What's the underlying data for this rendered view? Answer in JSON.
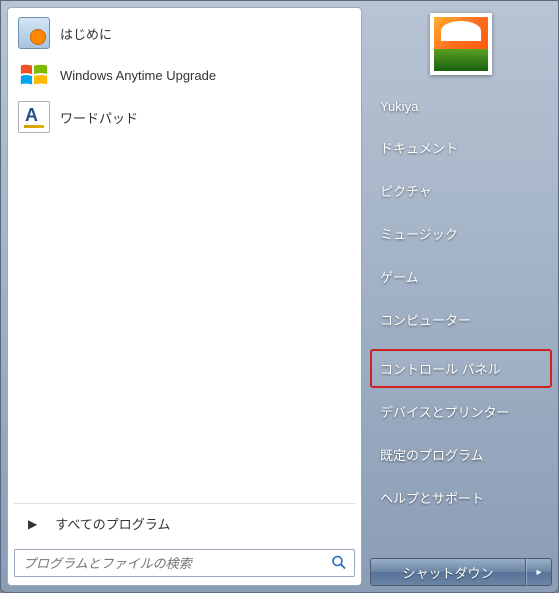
{
  "left": {
    "programs": [
      {
        "label": "はじめに",
        "icon": "getting-started-icon"
      },
      {
        "label": "Windows Anytime Upgrade",
        "icon": "windows-flag-icon"
      },
      {
        "label": "ワードパッド",
        "icon": "wordpad-icon"
      }
    ],
    "all_programs_label": "すべてのプログラム",
    "search_placeholder": "プログラムとファイルの検索"
  },
  "right": {
    "username": "Yukiya",
    "items": [
      {
        "label": "ドキュメント",
        "name": "documents"
      },
      {
        "label": "ピクチャ",
        "name": "pictures"
      },
      {
        "label": "ミュージック",
        "name": "music"
      },
      {
        "label": "ゲーム",
        "name": "games"
      },
      {
        "label": "コンピューター",
        "name": "computer"
      },
      {
        "label": "コントロール パネル",
        "name": "control-panel",
        "highlighted": true
      },
      {
        "label": "デバイスとプリンター",
        "name": "devices-printers"
      },
      {
        "label": "既定のプログラム",
        "name": "default-programs"
      },
      {
        "label": "ヘルプとサポート",
        "name": "help-support"
      }
    ],
    "shutdown_label": "シャットダウン"
  }
}
